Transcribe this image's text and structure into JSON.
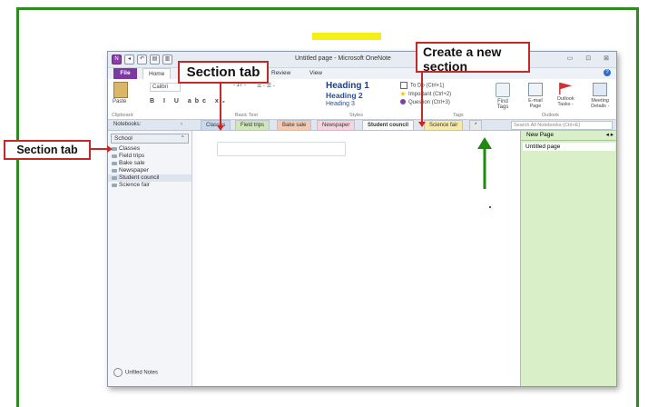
{
  "window": {
    "title": "Untitled page - Microsoft OneNote",
    "controls": [
      "▭",
      "⊡",
      "⊠"
    ]
  },
  "quick_access": [
    "N",
    "◂",
    "↶",
    "▤",
    "▥",
    "⊘"
  ],
  "ribbon_tabs": {
    "file": "File",
    "home": "Home",
    "review": "Review",
    "view": "View"
  },
  "ribbon": {
    "paste": "Paste",
    "clipboard": "Clipboard",
    "font_name": "Calibri",
    "font_size": "- 17 -",
    "format_row": "B I U abc x₂",
    "list_row": "☰ - ☰ -",
    "basic_text": "Basic Text",
    "styles": {
      "h1": "Heading 1",
      "h2": "Heading 2",
      "h3": "Heading 3",
      "label": "Styles"
    },
    "tags": {
      "todo": "To Do (Ctrl+1)",
      "important": "Important (Ctrl+2)",
      "question": "Question (Ctrl+3)",
      "label": "Tags"
    },
    "find_tags": "Find Tags",
    "outlook": {
      "email": "E-mail Page",
      "tasks": "Outlook Tasks -",
      "meeting": "Meeting Details -",
      "label": "Outlook"
    }
  },
  "notebooks_label": "Notebooks:",
  "section_tabs": [
    {
      "label": "Classes",
      "color": "#c9d8ee"
    },
    {
      "label": "Field trips",
      "color": "#cfe6b8"
    },
    {
      "label": "Bake sale",
      "color": "#f5c9b0"
    },
    {
      "label": "Newspaper",
      "color": "#f6d3df"
    },
    {
      "label": "Student council",
      "color": "#fbfbfd"
    },
    {
      "label": "Science fair",
      "color": "#f7eaa7"
    },
    {
      "label": "*",
      "color": "#e8e8e8"
    }
  ],
  "search_placeholder": "Search All Notebooks (Ctrl+E)",
  "notebook": {
    "name": "School",
    "sections": [
      "Classes",
      "Field trips",
      "Bake sale",
      "Newspaper",
      "Student council",
      "Science fair"
    ],
    "unfiled": "Unfiled Notes"
  },
  "page_pane": {
    "new_page": "New Page",
    "pages": [
      "Untitled page"
    ]
  },
  "callouts": {
    "section_tab_top": "Section tab",
    "section_tab_left": "Section tab",
    "create_new": "Create a new section"
  },
  "colors": {
    "frame_green": "#2e8b1f",
    "callout_red": "#c62828",
    "arrow_green": "#1e8a12",
    "page_pane_green": "#d9efc7",
    "file_tab_purple": "#7b3aa0"
  }
}
